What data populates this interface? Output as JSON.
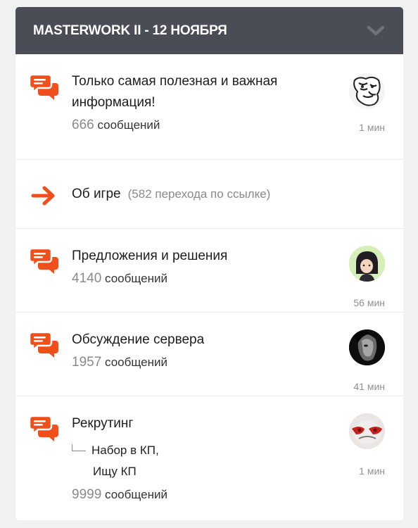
{
  "header": {
    "title": "MASTERWORK II - 12 НОЯБРЯ",
    "toggle_icon": "chevron-down-icon"
  },
  "colors": {
    "accent": "#f04e1b",
    "header_bg": "#4a4d56"
  },
  "forums": [
    {
      "title": "Только самая полезная и важная информация!",
      "count": "666",
      "count_label": "сообщений",
      "time": "1 мин",
      "icon": "chat-bubbles-icon"
    },
    {
      "title": "Об игре",
      "redirect": "(582 перехода по ссылке)",
      "icon": "arrow-right-icon"
    },
    {
      "title": "Предложения и решения",
      "count": "4140",
      "count_label": "сообщений",
      "time": "56 мин",
      "icon": "chat-bubbles-icon"
    },
    {
      "title": "Обсуждение сервера",
      "count": "1957",
      "count_label": "сообщений",
      "time": "41 мин",
      "icon": "chat-bubbles-icon"
    },
    {
      "title": "Рекрутинг",
      "subforums": [
        "Набор в КП,",
        "Ищу КП"
      ],
      "count": "9999",
      "count_label": "сообщений",
      "time": "1 мин",
      "icon": "chat-bubbles-icon"
    }
  ]
}
